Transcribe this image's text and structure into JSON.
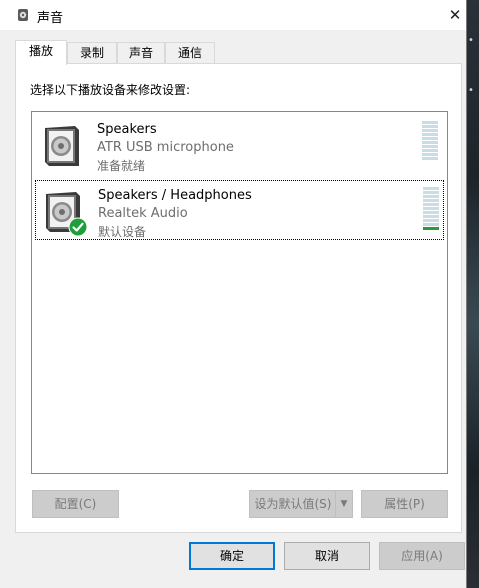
{
  "window": {
    "title": "声音",
    "close_glyph": "✕"
  },
  "tabs": [
    {
      "label": "播放",
      "active": true
    },
    {
      "label": "录制",
      "active": false
    },
    {
      "label": "声音",
      "active": false
    },
    {
      "label": "通信",
      "active": false
    }
  ],
  "instruction": "选择以下播放设备来修改设置:",
  "devices": [
    {
      "name": "Speakers",
      "subtitle": "ATR USB microphone",
      "status": "准备就绪",
      "is_default": false,
      "selected": false,
      "meter_level": 0.0
    },
    {
      "name": "Speakers / Headphones",
      "subtitle": "Realtek Audio",
      "status": "默认设备",
      "is_default": true,
      "selected": true,
      "meter_level": 0.0
    }
  ],
  "buttons": {
    "configure": "配置(C)",
    "set_default": "设为默认值(S)",
    "properties": "属性(P)",
    "ok": "确定",
    "cancel": "取消",
    "apply": "应用(A)"
  },
  "icons": {
    "window_icon": "speaker-icon",
    "default_badge": "green-check-icon",
    "dropdown": "chevron-down-icon"
  },
  "colors": {
    "accent": "#0078d7",
    "check_green": "#1f9e3a",
    "meter_unlit": "#c8dde6"
  }
}
